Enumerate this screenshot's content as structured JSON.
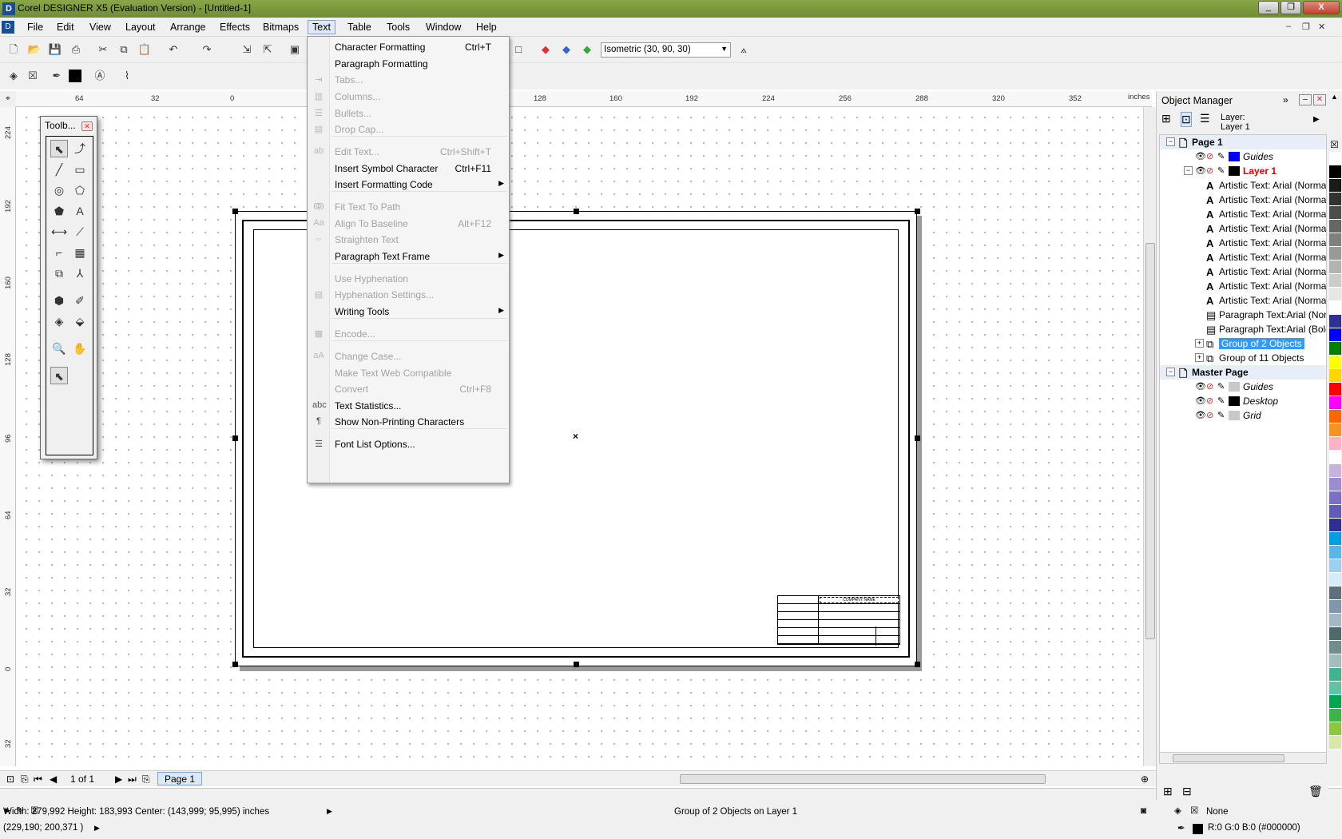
{
  "window": {
    "title": "Corel DESIGNER X5 (Evaluation Version) - [Untitled-1]",
    "controls": [
      "_",
      "❐",
      "X"
    ]
  },
  "menubar": {
    "items": [
      "File",
      "Edit",
      "View",
      "Layout",
      "Arrange",
      "Effects",
      "Bitmaps",
      "Text",
      "Table",
      "Tools",
      "Window",
      "Help"
    ],
    "active": "Text"
  },
  "toolbar": {
    "projection_select": "Isometric (30, 90, 30)"
  },
  "ruler": {
    "unit": "inches",
    "top_ticks": [
      "64",
      "32",
      "0",
      "128",
      "160",
      "192",
      "224",
      "256",
      "288",
      "320",
      "352"
    ],
    "left_ticks": [
      "224",
      "192",
      "160",
      "128",
      "96",
      "64",
      "32",
      "0",
      "32",
      "inches"
    ]
  },
  "text_menu": {
    "items": [
      {
        "label": "Character Formatting",
        "shortcut": "Ctrl+T",
        "disabled": false,
        "icon": ""
      },
      {
        "label": "Paragraph Formatting",
        "shortcut": "",
        "disabled": false,
        "icon": ""
      },
      {
        "label": "Tabs...",
        "shortcut": "",
        "disabled": true,
        "icon": "tabs-icon"
      },
      {
        "label": "Columns...",
        "shortcut": "",
        "disabled": true,
        "icon": "columns-icon"
      },
      {
        "label": "Bullets...",
        "shortcut": "",
        "disabled": true,
        "icon": "bullets-icon"
      },
      {
        "label": "Drop Cap...",
        "shortcut": "",
        "disabled": true,
        "icon": "drop-cap-icon"
      },
      {
        "label": "Edit Text...",
        "shortcut": "Ctrl+Shift+T",
        "disabled": true,
        "icon": "edit-text-icon"
      },
      {
        "label": "Insert Symbol Character",
        "shortcut": "Ctrl+F11",
        "disabled": false,
        "icon": ""
      },
      {
        "label": "Insert Formatting Code",
        "shortcut": "",
        "disabled": false,
        "icon": "",
        "submenu": true
      },
      {
        "label": "Fit Text To Path",
        "shortcut": "",
        "disabled": true,
        "icon": "fit-path-icon"
      },
      {
        "label": "Align To Baseline",
        "shortcut": "Alt+F12",
        "disabled": true,
        "icon": "align-baseline-icon"
      },
      {
        "label": "Straighten Text",
        "shortcut": "",
        "disabled": true,
        "icon": "straighten-icon"
      },
      {
        "label": "Paragraph Text Frame",
        "shortcut": "",
        "disabled": false,
        "icon": "",
        "submenu": true
      },
      {
        "label": "Use Hyphenation",
        "shortcut": "",
        "disabled": true,
        "icon": ""
      },
      {
        "label": "Hyphenation Settings...",
        "shortcut": "",
        "disabled": true,
        "icon": "hyphenation-icon"
      },
      {
        "label": "Writing Tools",
        "shortcut": "",
        "disabled": false,
        "icon": "",
        "submenu": true
      },
      {
        "label": "Encode...",
        "shortcut": "",
        "disabled": true,
        "icon": "encode-icon"
      },
      {
        "label": "Change Case...",
        "shortcut": "",
        "disabled": true,
        "icon": "change-case-icon"
      },
      {
        "label": "Make Text Web Compatible",
        "shortcut": "",
        "disabled": true,
        "icon": ""
      },
      {
        "label": "Convert",
        "shortcut": "Ctrl+F8",
        "disabled": true,
        "icon": ""
      },
      {
        "label": "Text Statistics...",
        "shortcut": "",
        "disabled": false,
        "icon": "text-statistics-icon"
      },
      {
        "label": "Show Non-Printing Characters",
        "shortcut": "",
        "disabled": false,
        "icon": "pilcrow-icon"
      },
      {
        "label": "Font List Options...",
        "shortcut": "",
        "disabled": false,
        "icon": "font-list-icon"
      }
    ]
  },
  "toolbox": {
    "title": "Toolb..."
  },
  "pagenav": {
    "counter": "1 of 1",
    "tab": "Page 1"
  },
  "object_manager": {
    "title": "Object Manager",
    "layer_label": "Layer:",
    "layer_name": "Layer 1",
    "rows": [
      {
        "type": "section",
        "label": "Page 1"
      },
      {
        "type": "layer",
        "label": "Guides",
        "color": "#0000ff",
        "italic": true
      },
      {
        "type": "layer",
        "label": "Layer 1",
        "color": "#000000",
        "red": true
      },
      {
        "type": "obj",
        "label": "Artistic Text: Arial (Normal)"
      },
      {
        "type": "obj",
        "label": "Artistic Text: Arial (Normal)"
      },
      {
        "type": "obj",
        "label": "Artistic Text: Arial (Normal)"
      },
      {
        "type": "obj",
        "label": "Artistic Text: Arial (Normal)"
      },
      {
        "type": "obj",
        "label": "Artistic Text: Arial (Normal)"
      },
      {
        "type": "obj",
        "label": "Artistic Text: Arial (Normal)"
      },
      {
        "type": "obj",
        "label": "Artistic Text: Arial (Normal)"
      },
      {
        "type": "obj",
        "label": "Artistic Text: Arial (Normal)"
      },
      {
        "type": "obj",
        "label": "Artistic Text: Arial (Normal)"
      },
      {
        "type": "para",
        "label": "Paragraph Text:Arial (Normal)"
      },
      {
        "type": "para",
        "label": "Paragraph Text:Arial (Bold)"
      },
      {
        "type": "group",
        "label": "Group of 2 Objects",
        "selected": true
      },
      {
        "type": "group",
        "label": "Group of 11 Objects"
      },
      {
        "type": "section",
        "label": "Master Page"
      },
      {
        "type": "layer",
        "label": "Guides",
        "color": "#c8c8c8",
        "italic": true
      },
      {
        "type": "layer",
        "label": "Desktop",
        "color": "#000000",
        "italic": true
      },
      {
        "type": "layer",
        "label": "Grid",
        "color": "#c8c8c8",
        "italic": true
      }
    ]
  },
  "palette": [
    "#ffffff",
    "#000000",
    "#1a1a1a",
    "#333333",
    "#4d4d4d",
    "#666666",
    "#808080",
    "#999999",
    "#b3b3b3",
    "#cccccc",
    "#e6e6e6",
    "#ffffff",
    "#2e3192",
    "#0000ff",
    "#008000",
    "#ffff00",
    "#ffd700",
    "#ff0000",
    "#ff00ff",
    "#ff6600",
    "#f7941d",
    "#ffb3c1",
    "#ffffff",
    "#c7b2de",
    "#9b8bd1",
    "#7b6fc6",
    "#605cb8",
    "#2f2f8f",
    "#00a0e0",
    "#57b7e6",
    "#99d1ef",
    "#d5ecf8",
    "#5f6f7f",
    "#8096aa",
    "#a5b6c6",
    "#4d6b6b",
    "#6f8f8f",
    "#9fbfbf",
    "#3fb58f",
    "#5fc4a6",
    "#00a651",
    "#39b54a",
    "#8dc63f",
    "#d7e8a8"
  ],
  "status": {
    "dimensions": "Width: 279,992  Height: 183,993  Center: (143,999; 95,995)  inches",
    "cursor": "(229,190; 200,371 )",
    "selection": "Group of 2 Objects on Layer 1",
    "fill": "None",
    "outline": "R:0 G:0 B:0 (#000000)"
  },
  "title_block_label": "COMPANY NAME"
}
